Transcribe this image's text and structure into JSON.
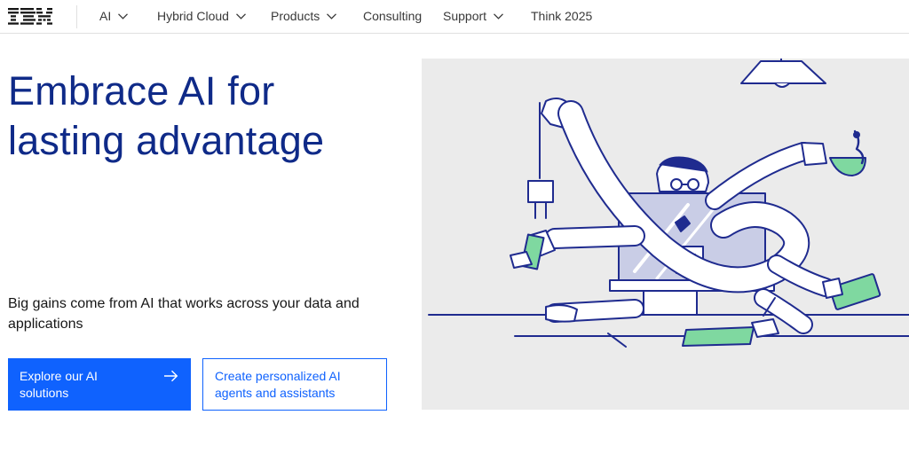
{
  "brand": {
    "logo_text": "IBM"
  },
  "nav": {
    "items": [
      {
        "label": "AI",
        "has_dropdown": true
      },
      {
        "label": "Hybrid Cloud",
        "has_dropdown": true
      },
      {
        "label": "Products",
        "has_dropdown": true
      },
      {
        "label": "Consulting",
        "has_dropdown": false
      },
      {
        "label": "Support",
        "has_dropdown": true
      },
      {
        "label": "Think 2025",
        "has_dropdown": false
      }
    ]
  },
  "hero": {
    "title_line1": "Embrace AI for",
    "title_line2": "lasting advantage",
    "subtitle": "Big gains come from AI that works across your data and applications",
    "primary_cta": "Explore our AI solutions",
    "secondary_cta": "Create personalized AI agents and assistants"
  },
  "colors": {
    "accent": "#0f62fe",
    "title": "#0f2a88",
    "illustration_line": "#1f2b8f",
    "illustration_green": "#7fd8a0",
    "illustration_bg": "#ebebeb"
  },
  "icons": [
    "chevron-down-icon",
    "arrow-right-icon",
    "ibm-logo"
  ]
}
